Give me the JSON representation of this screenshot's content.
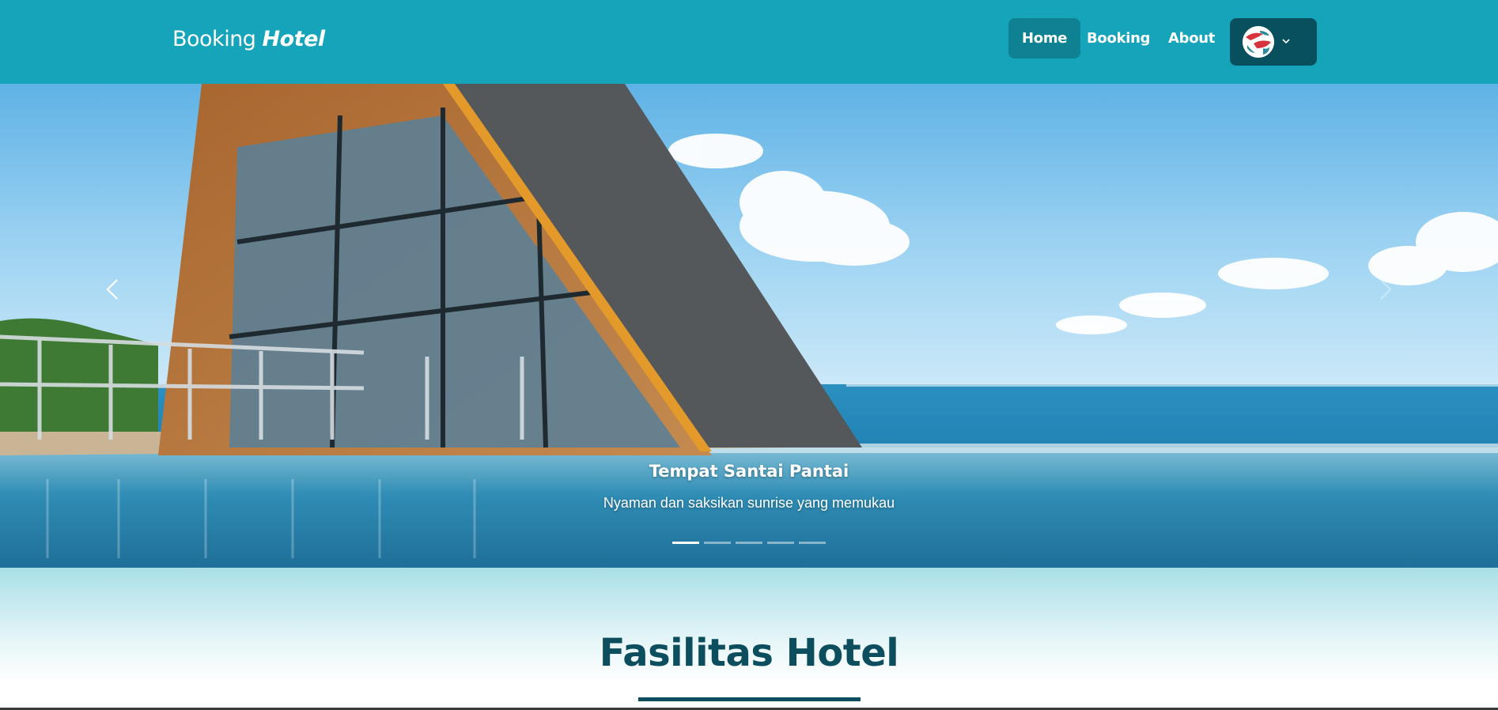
{
  "navbar": {
    "brand_prefix": "Booking",
    "brand_emphasis": "Hotel",
    "links": [
      {
        "label": "Home",
        "active": true
      },
      {
        "label": "Booking",
        "active": false
      },
      {
        "label": "About",
        "active": false
      }
    ],
    "language_icon": "flag-icon",
    "colors": {
      "background": "#16a4bb",
      "active_link": "#0e8193",
      "language_button": "#08505e"
    }
  },
  "carousel": {
    "slides_count": 5,
    "active_index": 0,
    "caption_title": "Tempat Santai Pantai",
    "caption_text": "Nyaman dan saksikan sunrise yang memukau",
    "prev_icon": "chevron-left-icon",
    "next_icon": "chevron-right-icon"
  },
  "facilities": {
    "title": "Fasilitas Hotel",
    "color": "#0c4e5e"
  }
}
